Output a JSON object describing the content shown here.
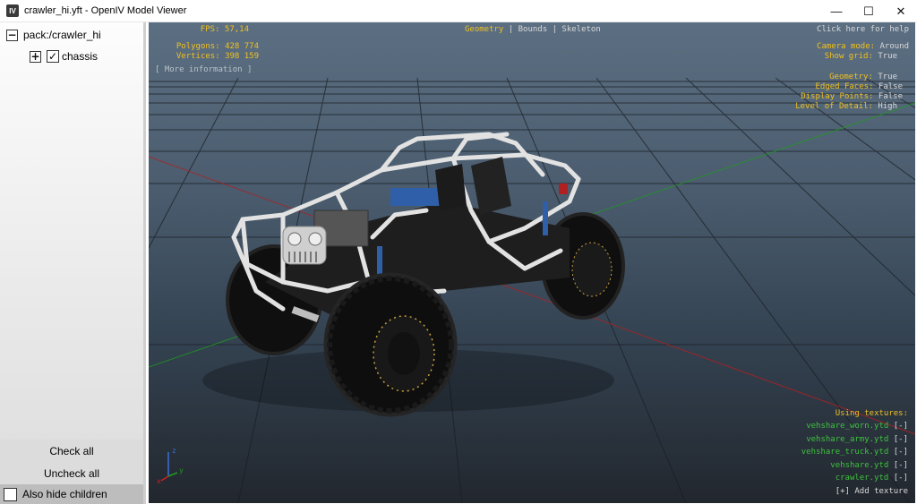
{
  "window": {
    "icon_text": "IV",
    "title": "crawler_hi.yft - OpenIV Model Viewer",
    "minimize": "—",
    "maximize": "☐",
    "close": "✕"
  },
  "tree": {
    "root": {
      "expander": "−",
      "label": "pack:/crawler_hi"
    },
    "child": {
      "expander": "+",
      "check": "✓",
      "label": "chassis"
    }
  },
  "buttons": {
    "check_all": "Check all",
    "uncheck_all": "Uncheck all",
    "also_hide_children": "Also hide children"
  },
  "hud": {
    "fps_label": "FPS:",
    "fps_value": "57,14",
    "polygons_label": "Polygons:",
    "polygons_value": "428 774",
    "vertices_label": "Vertices:",
    "vertices_value": "398 159",
    "more_info": "[ More information ]",
    "mode_geometry": "Geometry",
    "mode_sep1": "|",
    "mode_bounds": "Bounds",
    "mode_sep2": "|",
    "mode_skeleton": "Skeleton",
    "help": "Click here for help",
    "camera_label": "Camera mode:",
    "camera_value": "Around",
    "grid_label": "Show grid:",
    "grid_value": "True",
    "geometry_label": "Geometry:",
    "geometry_value": "True",
    "edged_label": "Edged Faces:",
    "edged_value": "False",
    "points_label": "Display Points:",
    "points_value": "False",
    "lod_label": "Level of Detail:",
    "lod_value": "High"
  },
  "textures": {
    "header": "Using textures:",
    "items": [
      {
        "name": "vehshare_worn.ytd",
        "remove": "[-]"
      },
      {
        "name": "vehshare_army.ytd",
        "remove": "[-]"
      },
      {
        "name": "vehshare_truck.ytd",
        "remove": "[-]"
      },
      {
        "name": "vehshare.ytd",
        "remove": "[-]"
      },
      {
        "name": "crawler.ytd",
        "remove": "[-]"
      }
    ],
    "add": "[+] Add texture"
  },
  "axis": {
    "x": "x",
    "y": "y",
    "z": "z"
  },
  "colors": {
    "hud_yellow": "#f0c020",
    "hud_green": "#3ec23e",
    "hud_white": "#d8d8d8"
  }
}
